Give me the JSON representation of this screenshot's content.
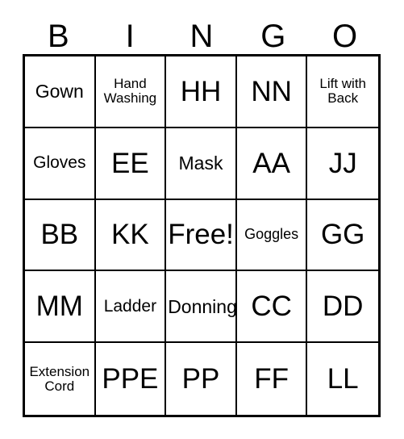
{
  "card": {
    "title": "Bingo Card",
    "header_letters": [
      "B",
      "I",
      "N",
      "G",
      "O"
    ],
    "colors": {
      "background": "#ffffff",
      "grid_line": "#000000",
      "text": "#000000"
    },
    "grid": {
      "columns": 5,
      "rows": 5,
      "free_space": "Free!",
      "cells": [
        [
          {
            "text": "Gown",
            "size": "md"
          },
          {
            "text": "Hand Washing",
            "size": "xxs"
          },
          {
            "text": "HH",
            "size": "xl"
          },
          {
            "text": "NN",
            "size": "xl"
          },
          {
            "text": "Lift with Back",
            "size": "xxs"
          }
        ],
        [
          {
            "text": "Gloves",
            "size": "sm"
          },
          {
            "text": "EE",
            "size": "xl"
          },
          {
            "text": "Mask",
            "size": "md"
          },
          {
            "text": "AA",
            "size": "xl"
          },
          {
            "text": "JJ",
            "size": "xl"
          }
        ],
        [
          {
            "text": "BB",
            "size": "xl"
          },
          {
            "text": "KK",
            "size": "xl"
          },
          {
            "text": "Free!",
            "size": "xl"
          },
          {
            "text": "Goggles",
            "size": "xs"
          },
          {
            "text": "GG",
            "size": "xl"
          }
        ],
        [
          {
            "text": "MM",
            "size": "xl"
          },
          {
            "text": "Ladder",
            "size": "sm"
          },
          {
            "text": "Donning",
            "size": "md"
          },
          {
            "text": "CC",
            "size": "xl"
          },
          {
            "text": "DD",
            "size": "xl"
          }
        ],
        [
          {
            "text": "Extension Cord",
            "size": "xxs"
          },
          {
            "text": "PPE",
            "size": "xl"
          },
          {
            "text": "PP",
            "size": "xl"
          },
          {
            "text": "FF",
            "size": "xl"
          },
          {
            "text": "LL",
            "size": "xl"
          }
        ]
      ]
    }
  }
}
